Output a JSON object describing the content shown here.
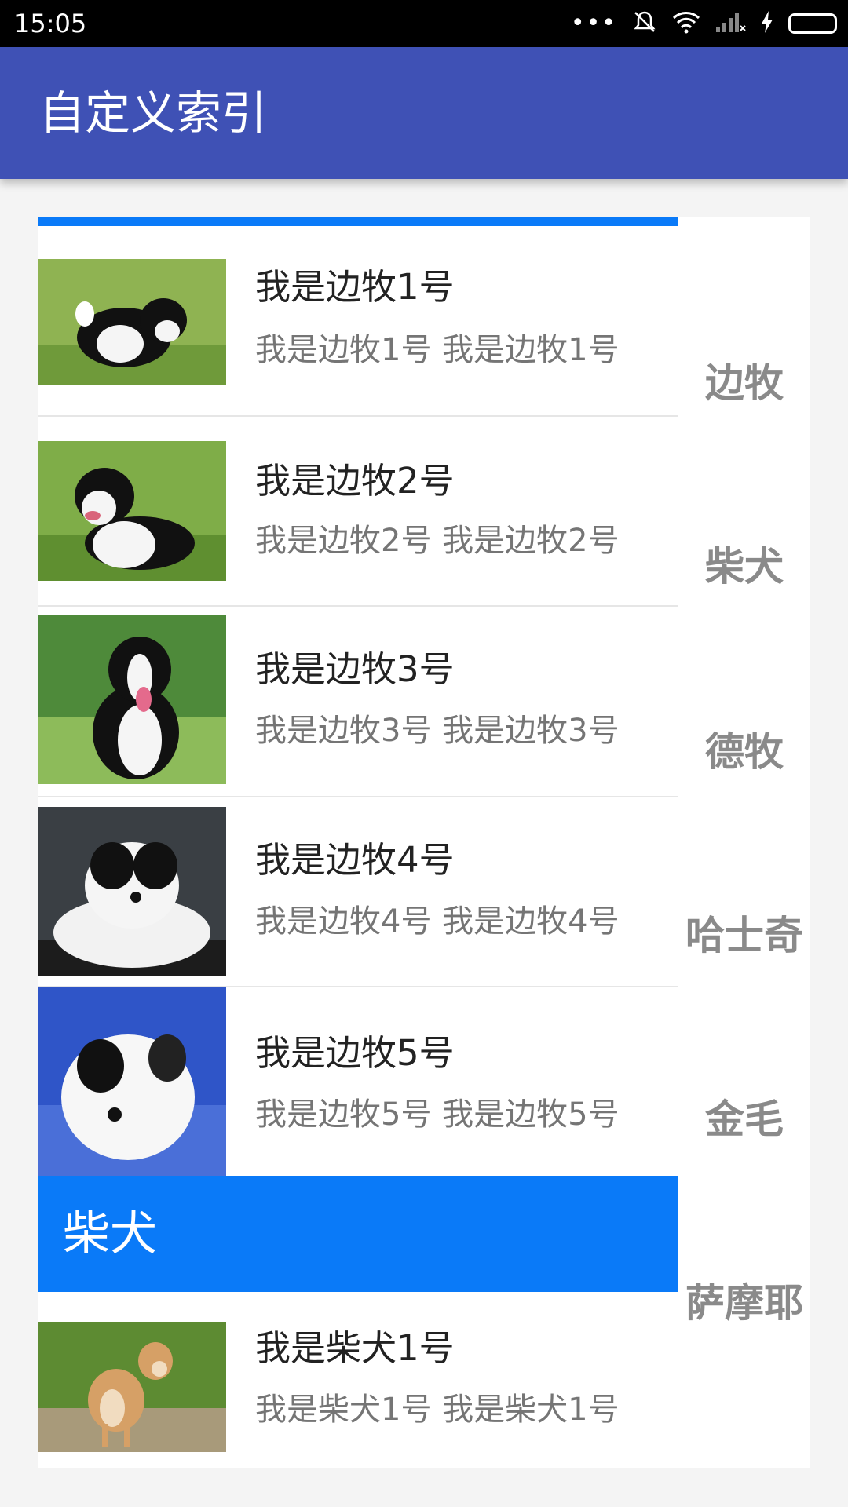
{
  "status_bar": {
    "time": "15:05",
    "icons": [
      "more-dots-icon",
      "mute-icon",
      "wifi-icon",
      "signal-icon",
      "charging-icon",
      "battery-icon"
    ]
  },
  "app_bar": {
    "title": "自定义索引"
  },
  "list": {
    "rows": [
      {
        "title": "我是边牧1号",
        "subtitle": "我是边牧1号 我是边牧1号",
        "image": "border-collie-photo"
      },
      {
        "title": "我是边牧2号",
        "subtitle": "我是边牧2号 我是边牧2号",
        "image": "border-collie-photo"
      },
      {
        "title": "我是边牧3号",
        "subtitle": "我是边牧3号 我是边牧3号",
        "image": "border-collie-photo"
      },
      {
        "title": "我是边牧4号",
        "subtitle": "我是边牧4号 我是边牧4号",
        "image": "border-collie-photo"
      },
      {
        "title": "我是边牧5号",
        "subtitle": "我是边牧5号 我是边牧5号",
        "image": "border-collie-photo"
      }
    ],
    "section_header": "柴犬",
    "section_rows": [
      {
        "title": "我是柴犬1号",
        "subtitle": "我是柴犬1号 我是柴犬1号",
        "image": "shiba-photo"
      }
    ]
  },
  "index_bar": {
    "items": [
      "边牧",
      "柴犬",
      "德牧",
      "哈士奇",
      "金毛",
      "萨摩耶"
    ]
  },
  "colors": {
    "toolbar": "#3f51b5",
    "accent": "#0a7af8",
    "status_bar": "#000000",
    "index_text": "#8a8a8a",
    "battery": "#5fd53b"
  }
}
